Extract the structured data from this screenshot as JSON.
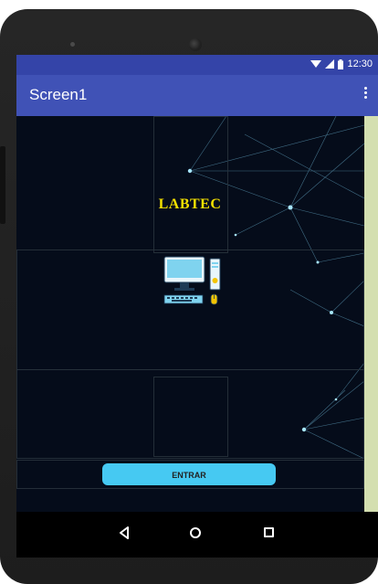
{
  "status_bar": {
    "time": "12:30",
    "icons": [
      "wifi-icon",
      "signal-icon",
      "battery-icon"
    ]
  },
  "app_bar": {
    "title": "Screen1",
    "menu_icon": "overflow-menu-icon"
  },
  "main": {
    "heading": "LABTEC",
    "image_icon": "computer-icon",
    "enter_button_label": "ENTRAR"
  },
  "nav_bar": {
    "icons": [
      "back-icon",
      "home-icon",
      "recent-apps-icon"
    ]
  },
  "colors": {
    "status_bar": "#3444a8",
    "app_bar": "#4052b6",
    "content_bg": "#050c1a",
    "heading": "#f4e000",
    "button": "#46c9f2",
    "right_strip": "#d4dfb0"
  }
}
